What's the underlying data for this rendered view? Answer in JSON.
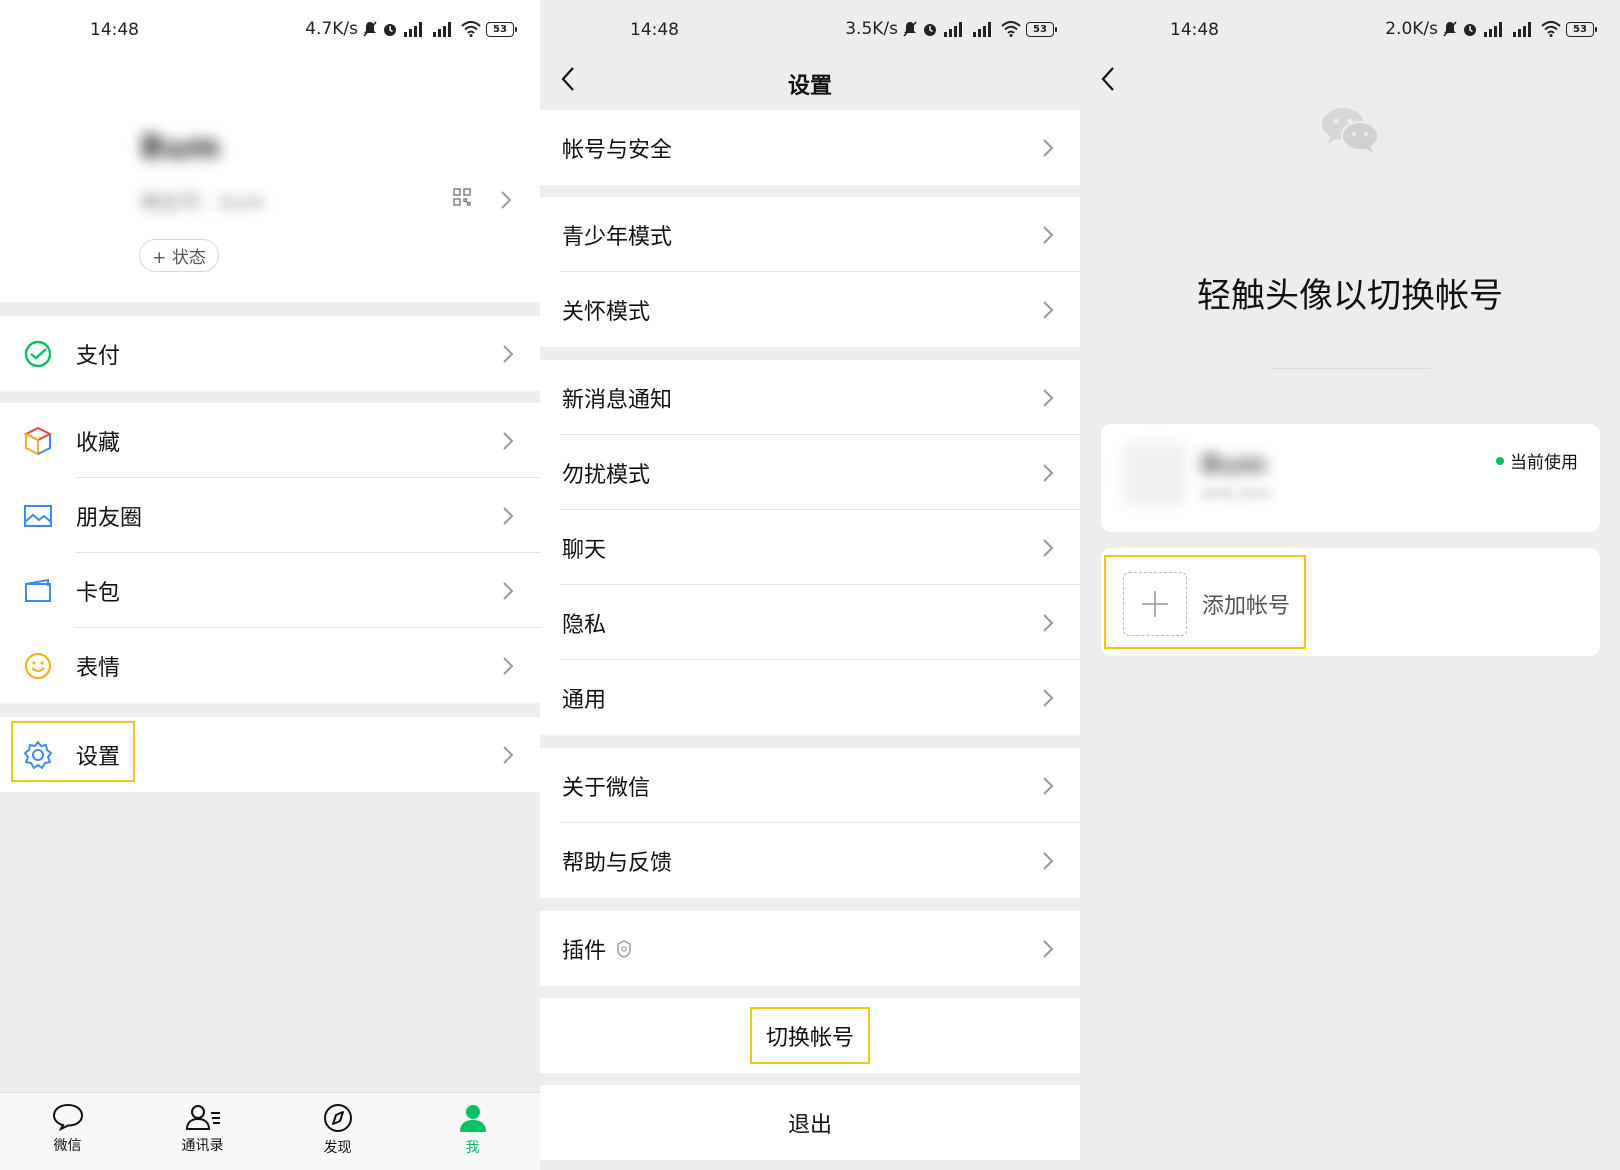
{
  "colors": {
    "accent": "#07c160",
    "highlight": "#f5c518",
    "background": "#ededed",
    "card": "#ffffff"
  },
  "screen1": {
    "status": {
      "time": "14:48",
      "speed": "4.7K/s",
      "battery": "53"
    },
    "profile": {
      "name": "Bum",
      "id": "微信号：bum",
      "status_button": "+ 状态"
    },
    "menu": {
      "pay": "支付",
      "favorites": "收藏",
      "moments": "朋友圈",
      "cards": "卡包",
      "stickers": "表情",
      "settings": "设置"
    },
    "tabs": [
      {
        "label": "微信",
        "icon": "chat-bubble-icon"
      },
      {
        "label": "通讯录",
        "icon": "contacts-icon"
      },
      {
        "label": "发现",
        "icon": "compass-icon"
      },
      {
        "label": "我",
        "icon": "person-icon"
      }
    ]
  },
  "screen2": {
    "status": {
      "time": "14:48",
      "speed": "3.5K/s",
      "battery": "53"
    },
    "title": "设置",
    "items": {
      "account_security": "帐号与安全",
      "teen_mode": "青少年模式",
      "care_mode": "关怀模式",
      "notifications": "新消息通知",
      "dnd": "勿扰模式",
      "chat": "聊天",
      "privacy": "隐私",
      "general": "通用",
      "about": "关于微信",
      "help": "帮助与反馈",
      "plugins": "插件"
    },
    "switch_account": "切换帐号",
    "logout": "退出"
  },
  "screen3": {
    "status": {
      "time": "14:48",
      "speed": "2.0K/s",
      "battery": "53"
    },
    "title": "轻触头像以切换帐号",
    "current_account": {
      "name": "Bum",
      "sub": "wxid_bum",
      "badge": "当前使用"
    },
    "add_account": "添加帐号"
  }
}
